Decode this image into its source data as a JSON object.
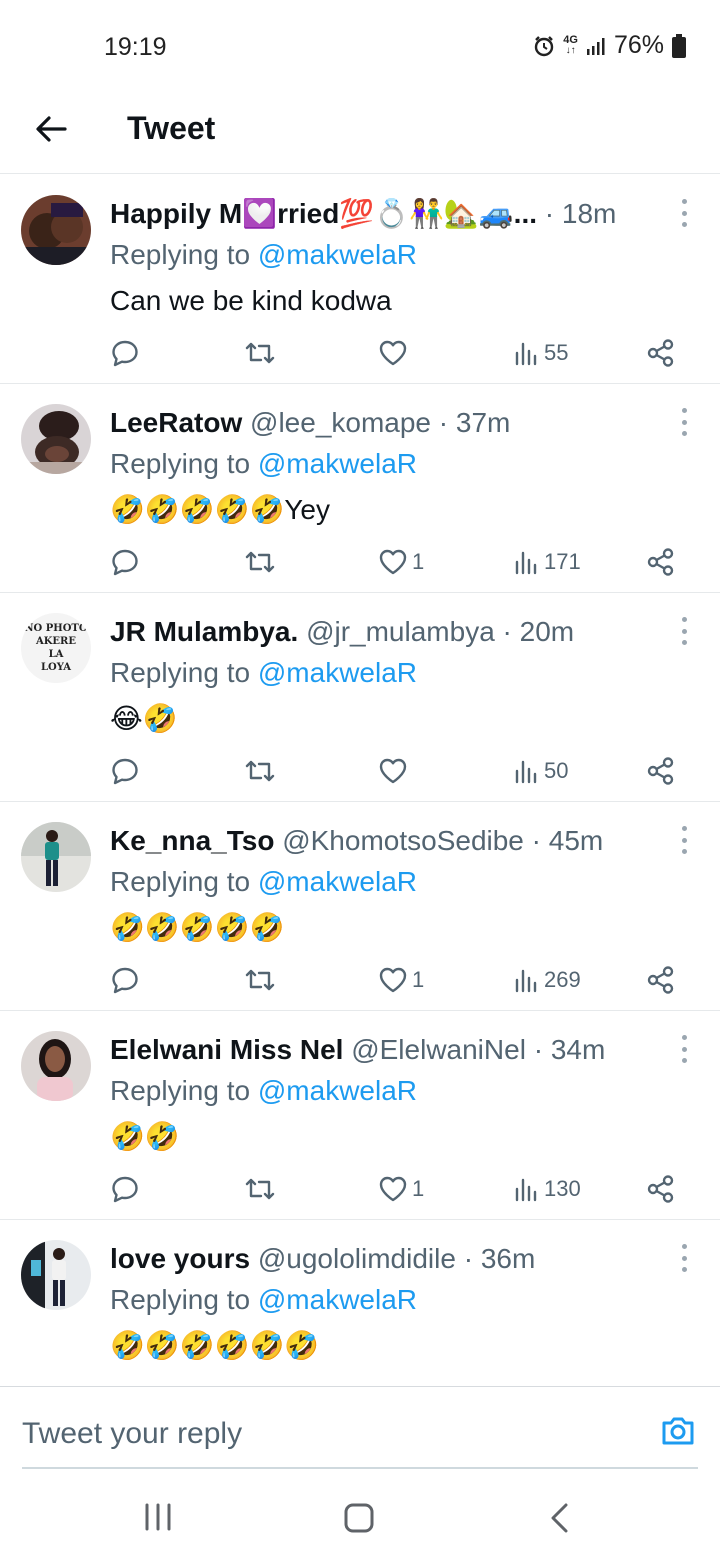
{
  "status": {
    "time": "19:19",
    "network": "4G",
    "battery": "76%"
  },
  "header": {
    "title": "Tweet"
  },
  "tweets": [
    {
      "name": "Happily M💟rried💯💍👫🏡🚙...",
      "handle": "",
      "time": "18m",
      "replying_label": "Replying to",
      "mention": "@makwelaR",
      "text": "Can we be kind kodwa",
      "likes": "",
      "views": "55"
    },
    {
      "name": "LeeRatow",
      "handle": "@lee_komape",
      "time": "37m",
      "replying_label": "Replying to",
      "mention": "@makwelaR",
      "text": "🤣🤣🤣🤣🤣Yey",
      "likes": "1",
      "views": "171"
    },
    {
      "name": "JR Mulambya.",
      "handle": "@jr_mulambya",
      "time": "20m",
      "replying_label": "Replying to",
      "mention": "@makwelaR",
      "text": "😂🤣",
      "likes": "",
      "views": "50",
      "avatar_text": [
        "NO PHOTO",
        "AKERE",
        "LA",
        "LOYA"
      ]
    },
    {
      "name": "Ke_nna_Tso",
      "handle": "@KhomotsoSedibe",
      "time": "45m",
      "replying_label": "Replying to",
      "mention": "@makwelaR",
      "text": "🤣🤣🤣🤣🤣",
      "likes": "1",
      "views": "269"
    },
    {
      "name": "Elelwani Miss Nel",
      "handle": "@ElelwaniNel",
      "time": "34m",
      "replying_label": "Replying to",
      "mention": "@makwelaR",
      "text": "🤣🤣",
      "likes": "1",
      "views": "130"
    },
    {
      "name": "love yours",
      "handle": "@ugololimdidile",
      "time": "36m",
      "replying_label": "Replying to",
      "mention": "@makwelaR",
      "text": "🤣🤣🤣🤣🤣🤣",
      "likes": "",
      "views": ""
    }
  ],
  "reply_bar": {
    "placeholder": "Tweet your reply"
  },
  "colors": {
    "accent": "#1d9bf0",
    "muted": "#536471",
    "text": "#0f1419",
    "divider": "#e6e9eb"
  },
  "icons": {
    "back": "arrow-left-icon",
    "reply": "speech-bubble-icon",
    "retweet": "retweet-arrows-icon",
    "like": "heart-icon",
    "views": "bar-chart-icon",
    "share": "share-nodes-icon",
    "more": "vertical-dots-icon",
    "camera": "camera-icon",
    "alarm": "alarm-clock-icon",
    "signal": "signal-bars-icon",
    "battery": "battery-icon"
  }
}
